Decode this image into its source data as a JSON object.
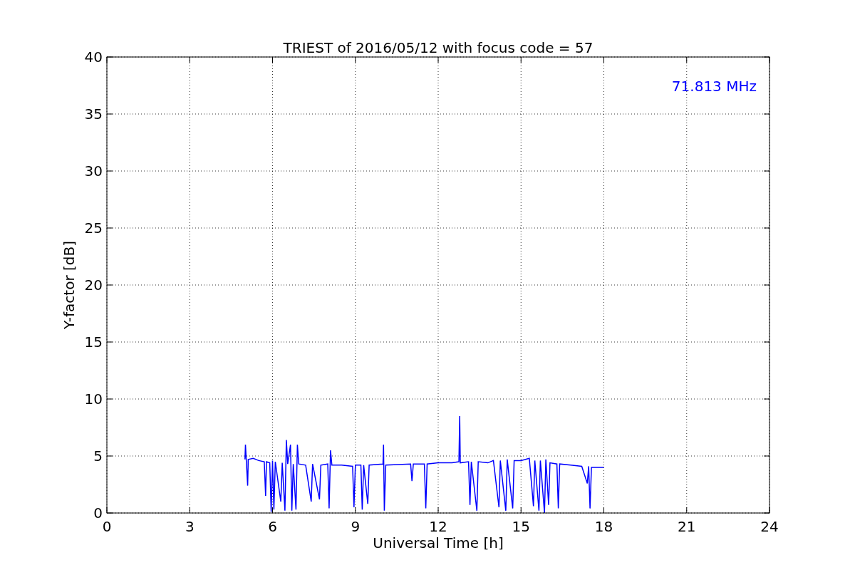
{
  "figure": {
    "chart_data": {
      "type": "line",
      "title": "TRIEST of 2016/05/12 with focus code = 57",
      "xlabel": "Universal Time [h]",
      "ylabel": "Y-factor [dB]",
      "xlim": [
        0,
        24
      ],
      "ylim": [
        0,
        40
      ],
      "xticks": [
        0,
        3,
        6,
        9,
        12,
        15,
        18,
        21,
        24
      ],
      "yticks": [
        0,
        5,
        10,
        15,
        20,
        25,
        30,
        35,
        40
      ],
      "x": [
        5.0,
        5.02,
        5.05,
        5.1,
        5.12,
        5.3,
        5.5,
        5.7,
        5.75,
        5.78,
        5.9,
        5.95,
        6.0,
        6.05,
        6.1,
        6.3,
        6.35,
        6.45,
        6.5,
        6.55,
        6.65,
        6.7,
        6.75,
        6.85,
        6.9,
        6.95,
        7.2,
        7.4,
        7.45,
        7.7,
        7.75,
        8.0,
        8.05,
        8.1,
        8.15,
        8.5,
        8.9,
        8.95,
        9.0,
        9.2,
        9.25,
        9.3,
        9.45,
        9.5,
        10.0,
        10.02,
        10.05,
        10.1,
        11.0,
        11.05,
        11.1,
        11.5,
        11.55,
        11.6,
        12.0,
        12.5,
        12.75,
        12.78,
        12.8,
        13.1,
        13.15,
        13.2,
        13.4,
        13.45,
        13.8,
        14.0,
        14.2,
        14.25,
        14.45,
        14.5,
        14.7,
        14.75,
        15.0,
        15.3,
        15.45,
        15.5,
        15.65,
        15.7,
        15.85,
        15.9,
        16.0,
        16.05,
        16.3,
        16.35,
        16.4,
        16.8,
        17.2,
        17.4,
        17.45,
        17.5,
        17.55,
        17.8,
        18.0
      ],
      "series": [
        {
          "color": "#0000ff",
          "values": [
            4.7,
            6.0,
            4.6,
            2.4,
            4.7,
            4.8,
            4.6,
            4.5,
            1.5,
            4.5,
            4.4,
            0.1,
            4.6,
            0.3,
            4.5,
            1.0,
            4.4,
            0.2,
            6.4,
            4.3,
            6.0,
            0.2,
            4.3,
            0.3,
            6.0,
            4.3,
            4.2,
            1.0,
            4.3,
            1.2,
            4.2,
            4.3,
            0.4,
            5.5,
            4.2,
            4.2,
            4.1,
            0.5,
            4.2,
            4.2,
            0.3,
            4.2,
            0.8,
            4.2,
            4.3,
            6.0,
            0.2,
            4.2,
            4.3,
            2.8,
            4.3,
            4.3,
            0.4,
            4.3,
            4.4,
            4.4,
            4.5,
            8.5,
            4.4,
            4.5,
            0.7,
            4.5,
            0.2,
            4.5,
            4.4,
            4.6,
            0.5,
            4.6,
            0.2,
            4.7,
            0.4,
            4.6,
            4.6,
            4.8,
            0.6,
            4.6,
            0.2,
            4.6,
            0.0,
            4.7,
            0.7,
            4.4,
            4.3,
            0.4,
            4.3,
            4.2,
            4.1,
            2.6,
            4.1,
            0.4,
            4.0,
            4.0,
            4.0
          ]
        }
      ],
      "annotations": [
        {
          "text": "71.813 MHz"
        }
      ],
      "grid": true
    }
  }
}
